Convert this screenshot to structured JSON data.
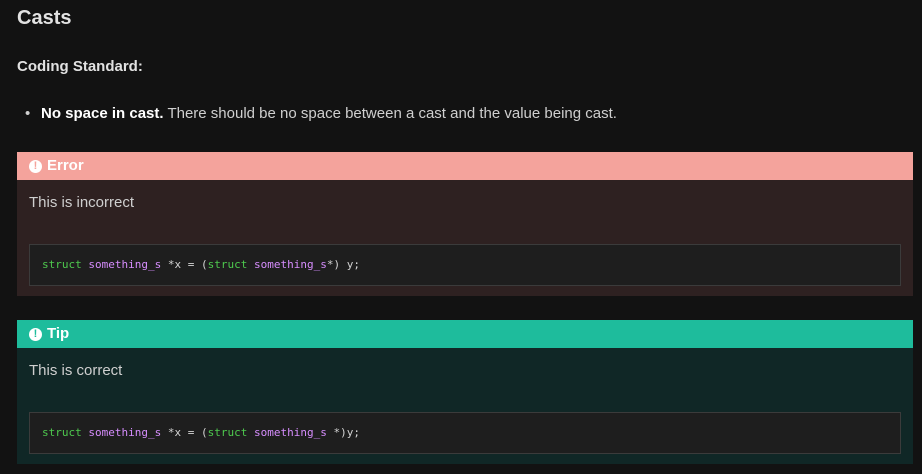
{
  "page": {
    "title": "Casts",
    "subtitle": "Coding Standard:",
    "rules": [
      {
        "bold": "No space in cast.",
        "text": " There should be no space between a cast and the value being cast."
      }
    ]
  },
  "error": {
    "icon": "exclamation-circle-icon",
    "title": "Error",
    "text": "This is incorrect",
    "code": {
      "t1": "struct",
      "t2": " ",
      "t3": "something_s",
      "t4": " *x = (",
      "t5": "struct",
      "t6": " ",
      "t7": "something_s",
      "t8": "*) y;"
    }
  },
  "tip": {
    "icon": "exclamation-circle-icon",
    "title": "Tip",
    "text": "This is correct",
    "code": {
      "t1": "struct",
      "t2": " ",
      "t3": "something_s",
      "t4": " *x = (",
      "t5": "struct",
      "t6": " ",
      "t7": "something_s",
      "t8": " *)y;"
    }
  },
  "colors": {
    "background": "#121212",
    "error_header": "#f4a39c",
    "error_body": "#2e2121",
    "tip_header": "#1ebc9c",
    "tip_body": "#102726",
    "code_keyword": "#4ec94e",
    "code_type": "#d68dfd"
  }
}
